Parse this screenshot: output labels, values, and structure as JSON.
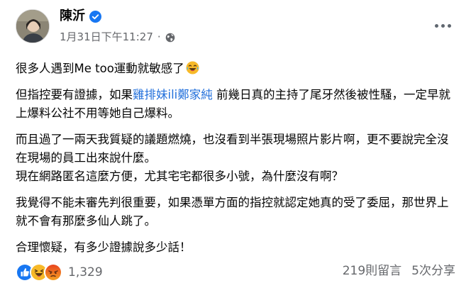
{
  "post": {
    "author": "陳沂",
    "timestamp": "1月31日下午11:27",
    "separator": "·",
    "privacy_icon": "globe-icon",
    "verified_icon": "verified-badge-icon",
    "more_icon": "more-options-icon"
  },
  "content": {
    "p1_text": "很多人遇到Me too運動就敏感了",
    "p1_emoji": "laughing-tears-emoji",
    "p2_before": "但指控要有證據，如果",
    "p2_mention": "雞排妹ili鄭家純",
    "p2_after": " 前幾日真的主持了尾牙然後被性騷，一定早就上爆料公社不用等她自己爆料。",
    "p3_line1": "而且過了一兩天我質疑的議題燃燒，也沒看到半張現場照片影片啊，更不要說完全沒在現場的員工出來說什麼。",
    "p3_line2": "現在網路匿名這麼方便，尤其宅宅都很多小號，為什麼沒有啊？",
    "p4": "我覺得不能未審先判很重要，如果憑單方面的指控就認定她真的受了委屈，那世界上就不會有那麼多仙人跳了。",
    "p5": "合理懷疑，有多少證據說多少話！"
  },
  "footer": {
    "reaction_icons": [
      "like-icon",
      "haha-icon",
      "angry-icon"
    ],
    "reaction_count": "1,329",
    "comments": "219則留言",
    "shares": "5次分享"
  },
  "colors": {
    "text": "#050505",
    "secondary": "#65676b",
    "link": "#216fdb",
    "verified": "#1877f2",
    "like": "#1877f2",
    "reaction_yellow": "#f7b928",
    "angry": "#e9710f"
  }
}
